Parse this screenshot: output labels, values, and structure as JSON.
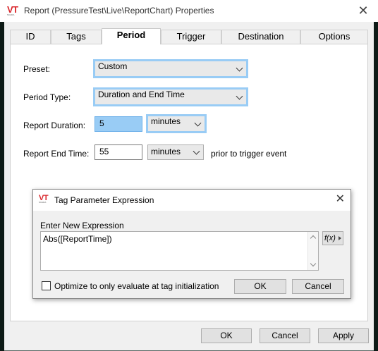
{
  "window": {
    "title": "Report (PressureTest\\Live\\ReportChart) Properties",
    "logo_text": "VT",
    "logo_sub": "SCADA"
  },
  "tabs": [
    {
      "label": "ID"
    },
    {
      "label": "Tags"
    },
    {
      "label": "Period",
      "active": true
    },
    {
      "label": "Trigger"
    },
    {
      "label": "Destination"
    },
    {
      "label": "Options"
    }
  ],
  "period": {
    "preset_label": "Preset:",
    "preset_value": "Custom",
    "period_type_label": "Period Type:",
    "period_type_value": "Duration and End Time",
    "duration_label": "Report Duration:",
    "duration_value": "5",
    "duration_unit": "minutes",
    "end_time_label": "Report End Time:",
    "end_time_value": "55",
    "end_time_unit": "minutes",
    "end_time_suffix": "prior to trigger event"
  },
  "dialog": {
    "title": "Tag Parameter Expression",
    "prompt": "Enter New Expression",
    "expression": "Abs([ReportTime])",
    "fx_label": "f(x)",
    "optimize_label": "Optimize to only evaluate at tag initialization",
    "optimize_checked": false,
    "ok_label": "OK",
    "cancel_label": "Cancel"
  },
  "footer": {
    "ok_label": "OK",
    "cancel_label": "Cancel",
    "apply_label": "Apply"
  },
  "colors": {
    "focus_border": "#99ccf5",
    "selected_field": "#99ccf5",
    "logo_red": "#d9262b"
  }
}
